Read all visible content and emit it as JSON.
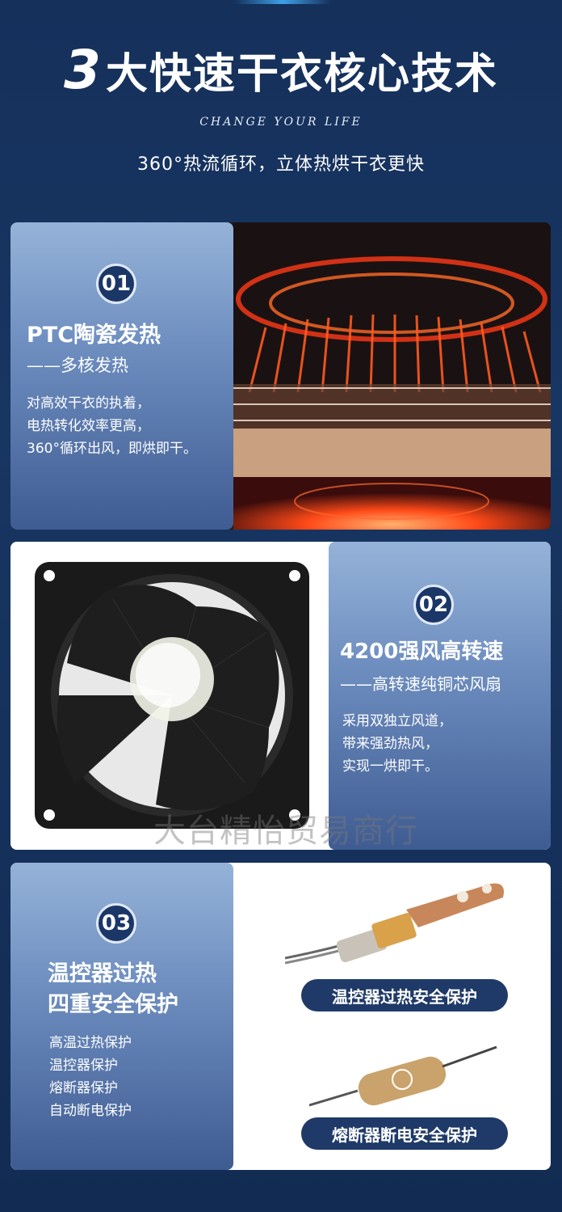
{
  "hero": {
    "title_num": "3",
    "title_text": "大快速干衣核心技术",
    "subtitle_en": "CHANGE YOUR LIFE",
    "subtitle": "360°热流循环，立体热烘干衣更快"
  },
  "features": [
    {
      "badge": "01",
      "title": "PTC陶瓷发热",
      "subtitle": "——多核发热",
      "desc": [
        "对高效干衣的执着，",
        "电热转化效率更高，",
        "360°循环出风，即烘即干。"
      ]
    },
    {
      "badge": "02",
      "title": "4200强风高转速",
      "subtitle": "——高转速纯铜芯风扇",
      "desc": [
        "采用双独立风道，",
        "带来强劲热风，",
        "实现一烘即干。"
      ]
    },
    {
      "badge": "03",
      "title_line1": "温控器过热",
      "title_line2": "四重安全保护",
      "desc": [
        "高温过热保护",
        "温控器保护",
        "熔断器保护",
        "自动断电保护"
      ],
      "pill1": "温控器过热安全保护",
      "pill2": "熔断器断电安全保护"
    }
  ],
  "watermark": "大台精怡贸易商行",
  "colors": {
    "navy": "#16305a",
    "panel_top": "#95b3d8",
    "panel_bottom": "#3f5c92",
    "pill": "#1f3a68"
  }
}
